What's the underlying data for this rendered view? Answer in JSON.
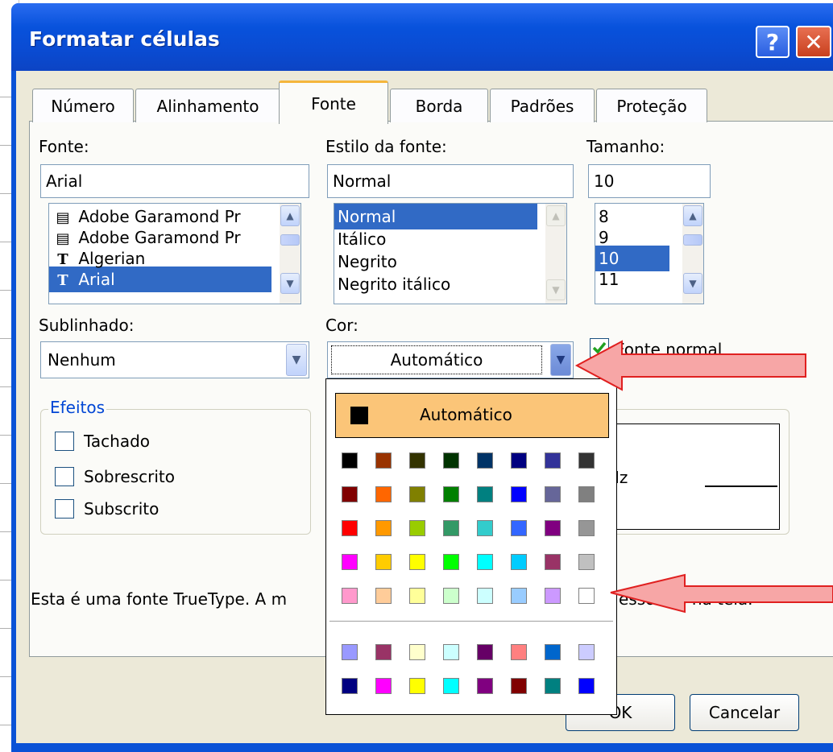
{
  "window": {
    "title": "Formatar células",
    "help_label": "?",
    "close_label": "✕"
  },
  "tabs": [
    "Número",
    "Alinhamento",
    "Fonte",
    "Borda",
    "Padrões",
    "Proteção"
  ],
  "font": {
    "label": "Fonte:",
    "value": "Arial",
    "items": [
      {
        "name": "Adobe Garamond Pr",
        "icon": "opentype-font-icon"
      },
      {
        "name": "Adobe Garamond Pr",
        "icon": "opentype-font-icon"
      },
      {
        "name": "Algerian",
        "icon": "truetype-font-icon"
      },
      {
        "name": "Arial",
        "icon": "truetype-font-icon"
      }
    ],
    "selected_index": 3
  },
  "style": {
    "label": "Estilo da fonte:",
    "value": "Normal",
    "items": [
      "Normal",
      "Itálico",
      "Negrito",
      "Negrito itálico"
    ],
    "selected_index": 0
  },
  "size": {
    "label": "Tamanho:",
    "value": "10",
    "items": [
      "8",
      "9",
      "10",
      "11"
    ],
    "selected_index": 2
  },
  "underline": {
    "label": "Sublinhado:",
    "value": "Nenhum"
  },
  "color": {
    "label": "Cor:",
    "value": "Automático"
  },
  "normal_font": {
    "label": "Fonte normal",
    "checked": true
  },
  "effects": {
    "title": "Efeitos",
    "items": [
      {
        "label": "Tachado",
        "checked": false
      },
      {
        "label": "Sobrescrito",
        "checked": false
      },
      {
        "label": "Subscrito",
        "checked": false
      }
    ]
  },
  "preview": {
    "visible_text": "Iz"
  },
  "description": {
    "left": "Esta é uma fonte TrueType. A m",
    "right": "essora e na tela."
  },
  "color_popup": {
    "automatic_label": "Automático",
    "automatic_swatch": "#000000",
    "main_palette": [
      [
        "#000000",
        "#993300",
        "#333300",
        "#003300",
        "#003366",
        "#000080",
        "#333399",
        "#333333"
      ],
      [
        "#800000",
        "#ff6600",
        "#808000",
        "#008000",
        "#008080",
        "#0000ff",
        "#666699",
        "#808080"
      ],
      [
        "#ff0000",
        "#ff9900",
        "#99cc00",
        "#339966",
        "#33cccc",
        "#3366ff",
        "#800080",
        "#969696"
      ],
      [
        "#ff00ff",
        "#ffcc00",
        "#ffff00",
        "#00ff00",
        "#00ffff",
        "#00ccff",
        "#993366",
        "#c0c0c0"
      ],
      [
        "#ff99cc",
        "#ffcc99",
        "#ffff99",
        "#ccffcc",
        "#ccffff",
        "#99ccff",
        "#cc99ff",
        "#ffffff"
      ]
    ],
    "chart_palette": [
      [
        "#9999ff",
        "#993366",
        "#ffffcc",
        "#ccffff",
        "#660066",
        "#ff8080",
        "#0066cc",
        "#ccccff"
      ],
      [
        "#000080",
        "#ff00ff",
        "#ffff00",
        "#00ffff",
        "#800080",
        "#800000",
        "#008080",
        "#0000ff"
      ]
    ]
  },
  "buttons": {
    "ok": "OK",
    "cancel": "Cancelar"
  },
  "annotations": {
    "arrow_color": "#f7a6a6",
    "arrow_border": "#e02020"
  }
}
